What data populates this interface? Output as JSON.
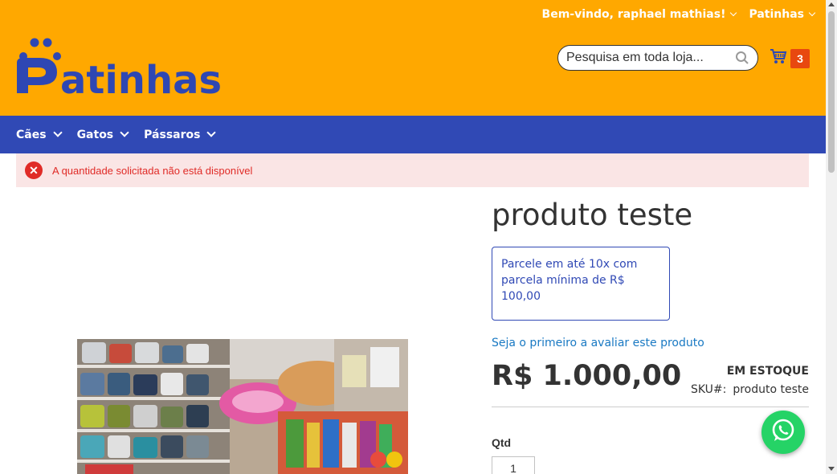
{
  "header": {
    "welcome": "Bem-vindo, raphael mathias!",
    "store_switcher": "Patinhas",
    "logo_text": "Patinhas",
    "search_placeholder": "Pesquisa em toda loja...",
    "cart_count": "3",
    "colors": {
      "background": "#FFA800",
      "logo": "#2E47B3",
      "cart_badge": "#E8480F"
    }
  },
  "nav": {
    "items": [
      {
        "label": "Cães"
      },
      {
        "label": "Gatos"
      },
      {
        "label": "Pássaros"
      }
    ],
    "color": "#3049B5"
  },
  "message": {
    "type": "error",
    "text": "A quantidade solicitada não está disponível"
  },
  "product": {
    "title": "produto teste",
    "installments": "Parcele em até 10x com parcela mínima de R$ 100,00",
    "review_link": "Seja o primeiro a avaliar este produto",
    "price": "R$ 1.000,00",
    "stock": "EM ESTOQUE",
    "sku_label": "SKU#:",
    "sku_value": "produto teste",
    "qty_label": "Qtd",
    "qty_value": "1"
  },
  "icons": {
    "search": "search-icon",
    "cart": "shopping-cart-icon",
    "error": "error-icon",
    "whatsapp": "whatsapp-icon"
  }
}
